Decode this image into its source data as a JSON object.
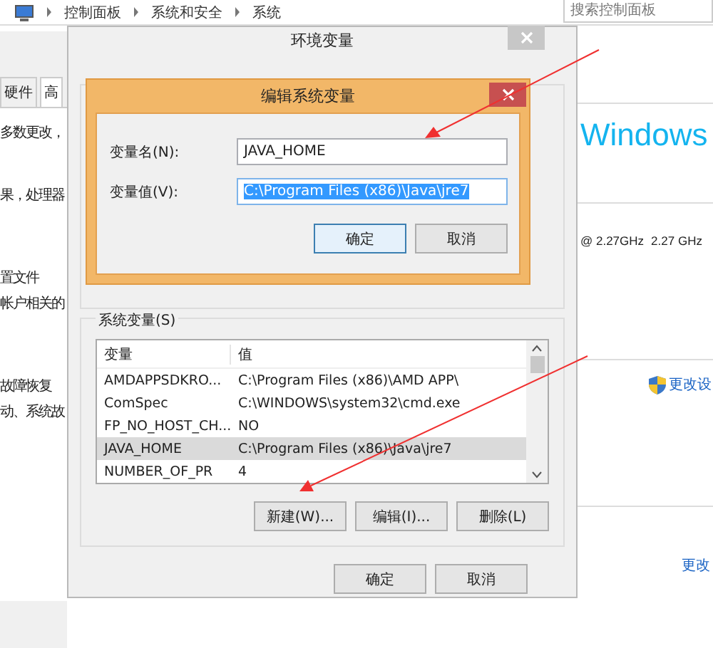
{
  "control_panel": {
    "breadcrumb": [
      "控制面板",
      "系统和安全",
      "系统"
    ],
    "search": {
      "placeholder": "搜索控制面板"
    },
    "brand": "Windows",
    "cpu": [
      "@ 2.27GHz",
      "2.27 GHz"
    ],
    "links": [
      "更改设",
      "更改"
    ]
  },
  "system_properties": {
    "tabs": [
      {
        "label": "硬件",
        "selected": false
      },
      {
        "label": "高",
        "selected": true
      }
    ],
    "texts": [
      "多数更改，",
      "果，处理器"
    ],
    "sections": [
      {
        "title": "置文件",
        "text": "帐户相关的"
      },
      {
        "title": "故障恢复",
        "text": "动、系统故"
      }
    ]
  },
  "env_dialog": {
    "title": "环境变量",
    "system_vars": {
      "label": "系统变量(S)",
      "columns": [
        "变量",
        "值"
      ],
      "rows": [
        {
          "name": "AMDAPPSDKRO...",
          "value": "C:\\Program Files (x86)\\AMD APP\\",
          "selected": false
        },
        {
          "name": "ComSpec",
          "value": "C:\\WINDOWS\\system32\\cmd.exe",
          "selected": false
        },
        {
          "name": "FP_NO_HOST_CH...",
          "value": "NO",
          "selected": false
        },
        {
          "name": "JAVA_HOME",
          "value": "C:\\Program Files (x86)\\Java\\jre7",
          "selected": true
        },
        {
          "name": "NUMBER_OF_PR",
          "value": "4",
          "selected": false
        }
      ]
    },
    "list_buttons": [
      "新建(W)...",
      "编辑(I)...",
      "删除(L)"
    ],
    "buttons": [
      "确定",
      "取消"
    ]
  },
  "edit_dialog": {
    "title": "编辑系统变量",
    "fields": [
      {
        "label": "变量名(N):",
        "value": "JAVA_HOME",
        "highlighted": false
      },
      {
        "label": "变量值(V):",
        "value": "C:\\Program Files (x86)\\Java\\jre7",
        "highlighted": true
      }
    ],
    "buttons": [
      {
        "label": "确定",
        "focused": true
      },
      {
        "label": "取消",
        "focused": false
      }
    ]
  }
}
